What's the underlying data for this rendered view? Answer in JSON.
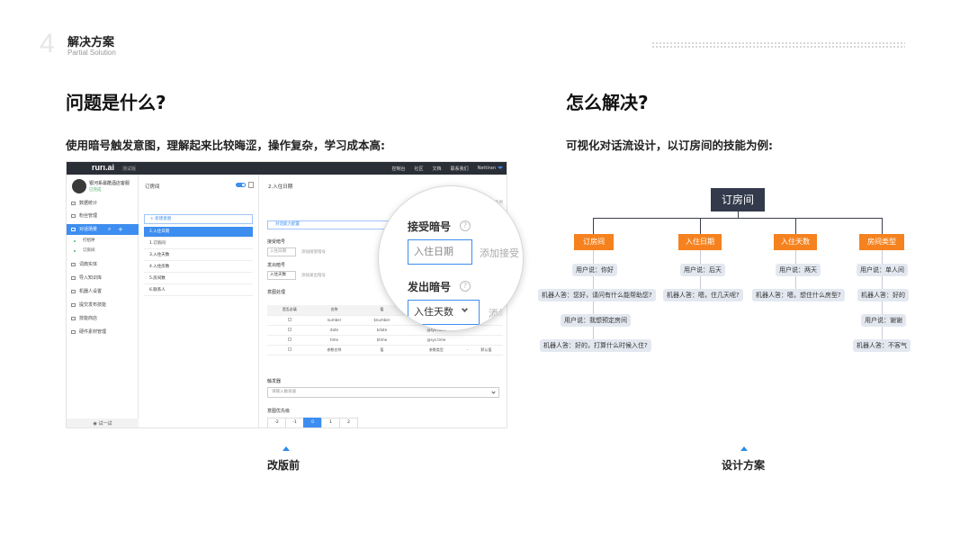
{
  "section": {
    "number": "4",
    "title": "解决方案",
    "subtitle": "Partial Solution"
  },
  "left": {
    "heading": "问题是什么?",
    "subheading": "使用暗号触发意图，理解起来比较晦涩，操作复杂，学习成本高:",
    "caption": "改版前"
  },
  "right": {
    "heading": "怎么解决?",
    "subheading": "可视化对话流设计，以订房间的技能为例:",
    "caption": "设计方案"
  },
  "screenshot": {
    "logo": "rurı.ai",
    "logo_sub": "测试版",
    "nav": [
      "控制台",
      "社区",
      "文档",
      "联系我们",
      "Nettiran"
    ],
    "profile_name": "银河系最酷酒店客服",
    "profile_role": "已完成",
    "sidebar": [
      "数据统计",
      "粉丝管理",
      "对话场景",
      "词典实体",
      "导入知识库",
      "机器人设置",
      "提交发布技能",
      "技能商店",
      "硬件素材管理"
    ],
    "sidebar_sub": [
      "打招呼",
      "订房间"
    ],
    "try_label": "试一试",
    "mid_title": "订房间",
    "add_new": "+ 新建意图",
    "mid_rows": [
      "2.入住日期",
      "1.订房间",
      "3.入住天数",
      "4.入住房数",
      "5.房间数",
      "6.联系人"
    ],
    "main_title": "2.入住日期",
    "main_hint": "请选择需要出现在对话中的多条例",
    "ability_box": "对话能力配置",
    "receive_label": "接受暗号",
    "receive_value": "入住日期",
    "receive_hint": "添加接受暗号",
    "send_label": "发出暗号",
    "send_value": "入住天数",
    "send_hint": "添加发出暗号",
    "intent_label": "意图处理",
    "table_headers": [
      "是否必填",
      "名称",
      "值",
      "",
      "",
      ""
    ],
    "table_rows": [
      [
        "",
        "number",
        "$number",
        "@sys.num",
        "",
        ""
      ],
      [
        "",
        "date",
        "$date",
        "@sys.date",
        "",
        ""
      ],
      [
        "",
        "time",
        "$time",
        "@sys.time",
        "",
        ""
      ],
      [
        "",
        "参数名称",
        "值",
        "参数类型",
        "-",
        "默认值"
      ]
    ],
    "trigger_label": "触发器",
    "trigger_placeholder": "请输入触发器",
    "priority_label": "意图优先级",
    "pager": [
      "-2",
      "-1",
      "0",
      "1",
      "2"
    ]
  },
  "magnifier": {
    "receive_label": "接受暗号",
    "receive_value": "入住日期",
    "receive_add": "添加接受",
    "send_label": "发出暗号",
    "send_value": "入住天数",
    "send_add": "添加"
  },
  "flow": {
    "root": "订房间",
    "branches": [
      {
        "label": "订房间",
        "bubbles": [
          "用户说：你好",
          "机器人答：您好，请问有什么能帮助您?",
          "用户说：我想预定房间",
          "机器人答：好的，打算什么时候入住?"
        ]
      },
      {
        "label": "入住日期",
        "bubbles": [
          "用户说：后天",
          "机器人答：嗯，住几天呢?"
        ]
      },
      {
        "label": "入住天数",
        "bubbles": [
          "用户说：两天",
          "机器人答：嗯，想住什么房型?"
        ]
      },
      {
        "label": "房间类型",
        "bubbles": [
          "用户说：单人间",
          "机器人答：好的",
          "用户说：谢谢",
          "机器人答：不客气"
        ]
      }
    ]
  },
  "colors": {
    "accent": "#3d8ef0",
    "flow_orange": "#f5821f",
    "flow_root": "#323a4b",
    "bubble": "#e3e8f0"
  }
}
